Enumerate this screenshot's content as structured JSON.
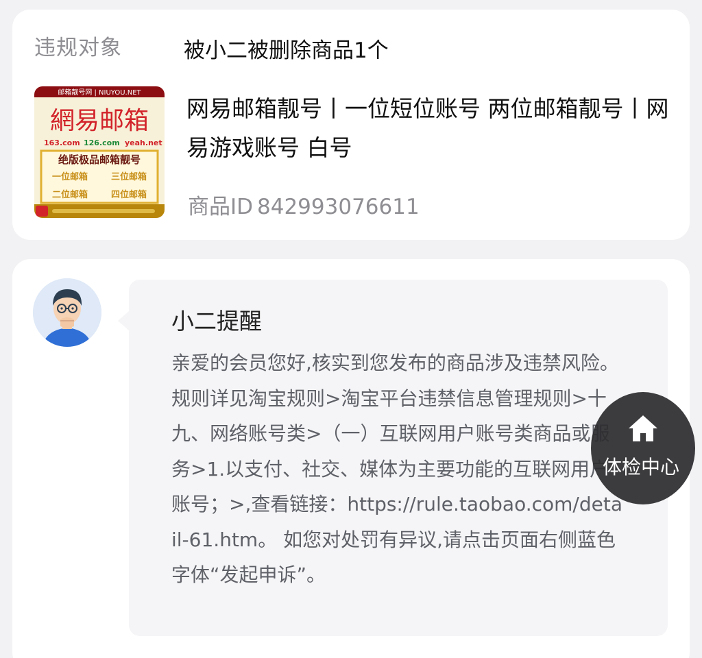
{
  "violation": {
    "label": "违规对象",
    "value": "被小二被删除商品1个"
  },
  "product": {
    "title": "网易邮箱靓号丨一位短位账号 两位邮箱靓号丨网易游戏账号 白号",
    "id_label": "商品ID",
    "id_value": "842993076611",
    "thumbnail": {
      "top_banner": "邮箱靓号网 | NIUYOU.NET",
      "brand": "網易邮箱",
      "domains": [
        "163.com",
        "126.com",
        "yeah.net"
      ],
      "tagline": "绝版极品邮箱靓号",
      "options": [
        "一位邮箱",
        "三位邮箱",
        "二位邮箱",
        "四位邮箱"
      ],
      "colors": {
        "brand_red": "#d2232a",
        "gold": "#e0b030",
        "paper": "#f7f1d9",
        "banner": "#8c0e12"
      }
    }
  },
  "notice": {
    "title": "小二提醒",
    "body": "亲爱的会员您好,核实到您发布的商品涉及违禁风险。规则详见淘宝规则>淘宝平台违禁信息管理规则>十九、网络账号类>（一）互联网用户账号类商品或服务>1.以支付、社交、媒体为主要功能的互联网用户账号；>,查看链接：https://rule.taobao.com/detail-61.htm。 如您对处罚有异议,请点击页面右侧蓝色字体“发起申诉”。"
  },
  "float_button": {
    "label": "体检中心",
    "icon": "home-icon"
  }
}
